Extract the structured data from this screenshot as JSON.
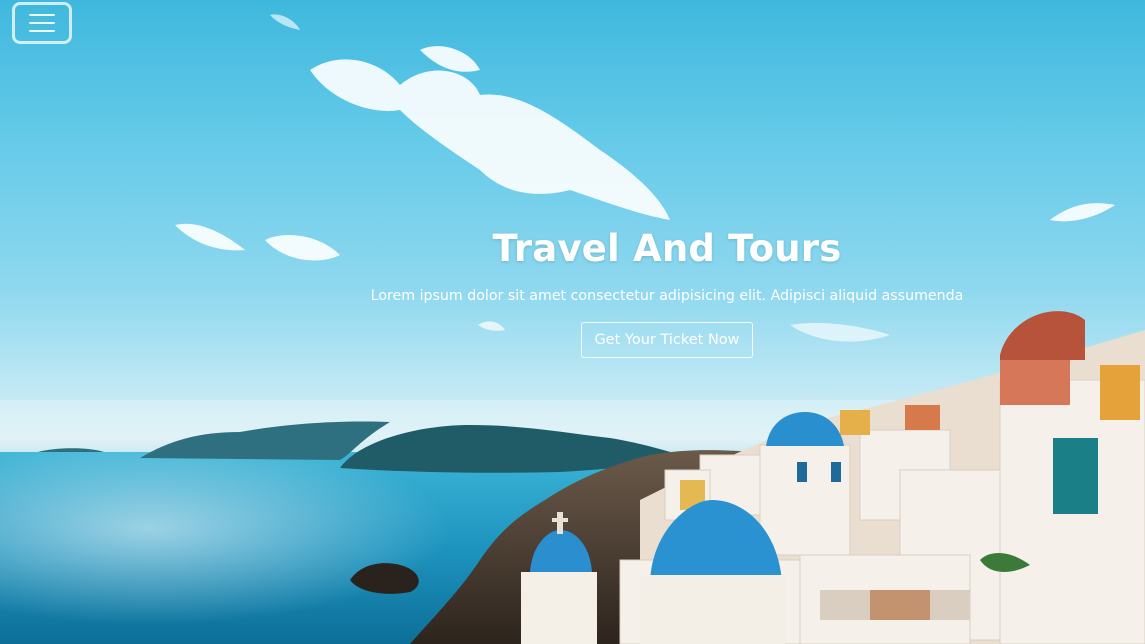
{
  "nav": {
    "menu_icon": "hamburger-menu-icon"
  },
  "hero": {
    "title": "Travel And Tours",
    "subtitle": "Lorem ipsum dolor sit amet consectetur adipisicing elit. Adipisci aliquid assumenda",
    "cta_label": "Get Your Ticket Now",
    "background": "santorini-coast-photo"
  },
  "colors": {
    "text": "#ffffff",
    "sky": "#3fb8dd",
    "sea": "#1b8fb7",
    "dome": "#2a8fcf"
  }
}
